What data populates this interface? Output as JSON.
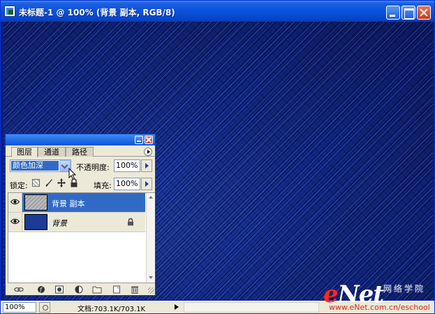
{
  "document": {
    "title": "未标题-1 @ 100% (背景 副本, RGB/8)",
    "canvas_color": "#132a8c"
  },
  "status_bar": {
    "zoom": "100%",
    "doc_size": "文档:703.1K/703.1K"
  },
  "layers_panel": {
    "tabs": [
      {
        "label": "图层",
        "active": true
      },
      {
        "label": "通道",
        "active": false
      },
      {
        "label": "路径",
        "active": false
      }
    ],
    "blend_mode": "颜色加深",
    "opacity_label": "不透明度:",
    "opacity_value": "100%",
    "lock_label": "锁定:",
    "fill_label": "填充:",
    "fill_value": "100%",
    "layers": [
      {
        "name": "背景 副本",
        "selected": true,
        "visible": true,
        "locked": false
      },
      {
        "name": "背景",
        "selected": false,
        "visible": true,
        "locked": true
      }
    ]
  },
  "watermark": {
    "logo_prefix": "e",
    "logo_rest": "Net",
    "cn_text": "网络学院",
    "url": "www.eNet.com.cn/eschool"
  },
  "colors": {
    "titlebar": "#0a52dc",
    "selection": "#316ac5",
    "panel_bg": "#ece9d8",
    "close_button": "#c73a16",
    "logo_red": "#ff2a1a"
  }
}
